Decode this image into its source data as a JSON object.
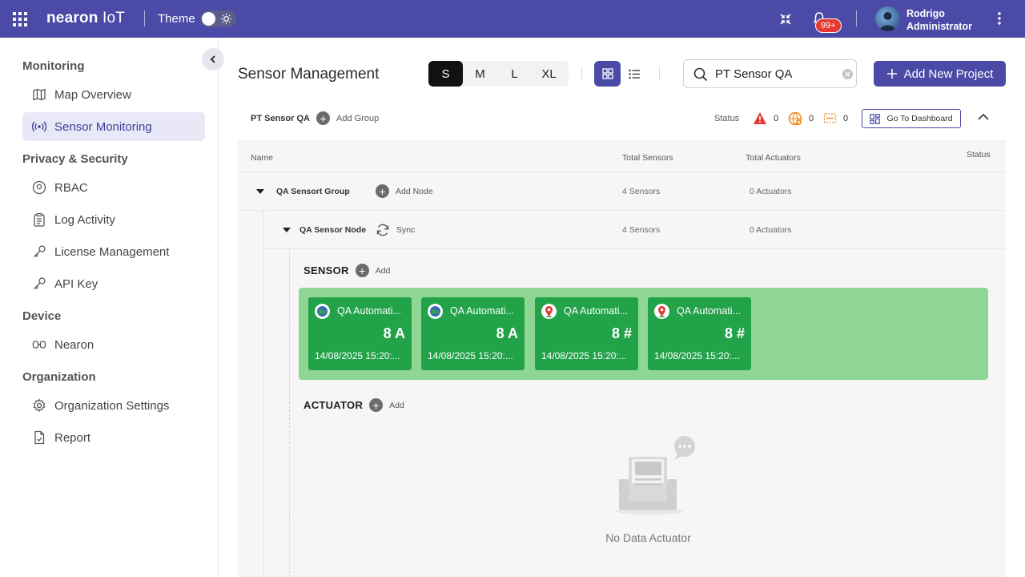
{
  "app": {
    "brand_bold": "nearon",
    "brand_light": "IoT",
    "theme_label": "Theme"
  },
  "header": {
    "notifications_badge": "99+",
    "user_first": "Rodrigo",
    "user_role": "Administrator"
  },
  "sidebar": {
    "sections": [
      {
        "title": "Monitoring",
        "items": [
          {
            "label": "Map Overview",
            "icon": "map-icon"
          },
          {
            "label": "Sensor Monitoring",
            "icon": "broadcast-icon",
            "active": true
          }
        ]
      },
      {
        "title": "Privacy & Security",
        "items": [
          {
            "label": "RBAC",
            "icon": "user-circle-icon"
          },
          {
            "label": "Log Activity",
            "icon": "clipboard-icon"
          },
          {
            "label": "License Management",
            "icon": "key-icon"
          },
          {
            "label": "API Key",
            "icon": "key-icon"
          }
        ]
      },
      {
        "title": "Device",
        "items": [
          {
            "label": "Nearon",
            "icon": "device-icon"
          }
        ]
      },
      {
        "title": "Organization",
        "items": [
          {
            "label": "Organization Settings",
            "icon": "gear-icon"
          },
          {
            "label": "Report",
            "icon": "document-icon"
          }
        ]
      }
    ]
  },
  "main": {
    "title": "Sensor Management",
    "sizes": [
      "S",
      "M",
      "L",
      "XL"
    ],
    "selected_size": "S",
    "search_value": "PT Sensor QA",
    "add_project_label": "Add New Project"
  },
  "project": {
    "name": "PT Sensor QA",
    "add_group_label": "Add Group",
    "status_label": "Status",
    "alert_count": "0",
    "offline_count": "0",
    "warning_count": "0",
    "dashboard_label": "Go To Dashboard"
  },
  "table": {
    "headers": {
      "name": "Name",
      "total_sensors": "Total Sensors",
      "total_actuators": "Total Actuators",
      "status": "Status"
    },
    "group": {
      "name": "QA Sensort Group",
      "action": "Add Node",
      "sensors": "4 Sensors",
      "actuators": "0 Actuators"
    },
    "node": {
      "name": "QA Sensor Node",
      "action": "Sync",
      "sensors": "4 Sensors",
      "actuators": "0 Actuators"
    }
  },
  "sensor_section": {
    "label": "SENSOR",
    "add_label": "Add",
    "cards": [
      {
        "name": "QA Automati...",
        "value": "8 A",
        "date": "14/08/2025 15:20:...",
        "icon": "globe-icon"
      },
      {
        "name": "QA Automati...",
        "value": "8 A",
        "date": "14/08/2025 15:20:...",
        "icon": "globe-icon"
      },
      {
        "name": "QA Automati...",
        "value": "8 #",
        "date": "14/08/2025 15:20:...",
        "icon": "map-pin-icon"
      },
      {
        "name": "QA Automati...",
        "value": "8 #",
        "date": "14/08/2025 15:20:...",
        "icon": "map-pin-icon"
      }
    ]
  },
  "actuator_section": {
    "label": "ACTUATOR",
    "add_label": "Add",
    "empty_text": "No Data Actuator"
  },
  "colors": {
    "primary": "#4b4aa6",
    "sensor_panel": "#8fd694",
    "sensor_card": "#22a249",
    "badge": "#e53935"
  }
}
